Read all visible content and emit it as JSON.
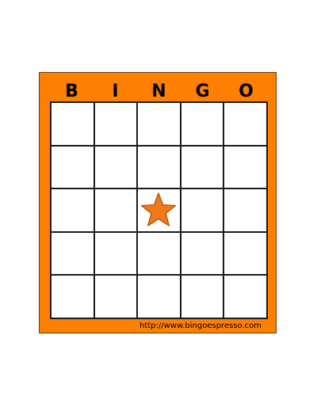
{
  "card": {
    "header_letters": [
      "B",
      "I",
      "N",
      "G",
      "O"
    ],
    "free_space_icon": "star-icon",
    "footer_url": "http://www.bingoespresso.com"
  },
  "colors": {
    "card_background": "#ff8000",
    "star_fill": "#f07a1a",
    "grid_lines": "#1a1a1a"
  }
}
